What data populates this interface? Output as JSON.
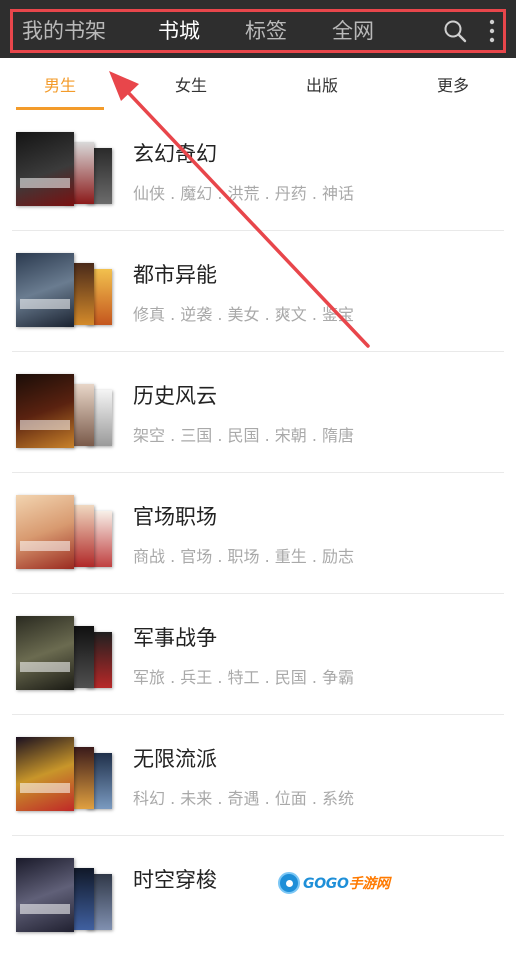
{
  "header": {
    "tabs": [
      {
        "label": "我的书架",
        "active": false
      },
      {
        "label": "书城",
        "active": true
      },
      {
        "label": "标签",
        "active": false
      },
      {
        "label": "全网",
        "active": false
      }
    ],
    "icons": [
      "search-icon",
      "more-vertical-icon"
    ],
    "highlight_color": "#e8464b"
  },
  "subtabs": {
    "items": [
      {
        "label": "男生",
        "active": true
      },
      {
        "label": "女生",
        "active": false
      },
      {
        "label": "出版",
        "active": false
      },
      {
        "label": "更多",
        "active": false
      }
    ],
    "accent_color": "#f39b2a"
  },
  "categories": [
    {
      "title": "玄幻奇幻",
      "tags": "仙侠 . 魔幻 . 洪荒 . 丹药 . 神话",
      "cover_text": "文臣猛将"
    },
    {
      "title": "都市异能",
      "tags": "修真 . 逆袭 . 美女 . 爽文 . 鉴宝",
      "cover_text": "最强狂兵"
    },
    {
      "title": "历史风云",
      "tags": "架空 . 三国 . 民国 . 宋朝 . 隋唐",
      "cover_text": "天才将帅"
    },
    {
      "title": "官场职场",
      "tags": "商战 . 官场 . 职场 . 重生 . 励志",
      "cover_text": "权色之路"
    },
    {
      "title": "军事战争",
      "tags": "军旅 . 兵王 . 特工 . 民国 . 争霸",
      "cover_text": "帝国霸主"
    },
    {
      "title": "无限流派",
      "tags": "科幻 . 未来 . 奇遇 . 位面 . 系统",
      "cover_text": ""
    },
    {
      "title": "时空穿梭",
      "tags": "",
      "cover_text": ""
    }
  ],
  "watermark": {
    "text_main": "GOGO",
    "text_accent": "手游网"
  }
}
